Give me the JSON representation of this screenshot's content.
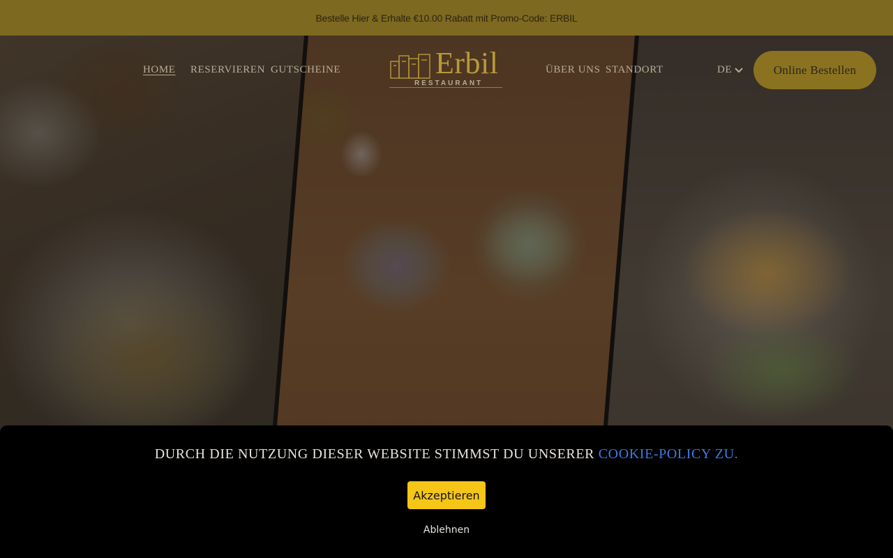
{
  "promo": {
    "text": "Bestelle Hier & Erhalte €10.00 Rabatt mit Promo-Code: ERBIL"
  },
  "nav": {
    "home": "HOME",
    "reserve": "RESERVIEREN",
    "vouchers": "GUTSCHEINE",
    "about": "ÜBER UNS",
    "location": "STANDORT",
    "language": "DE",
    "order_button": "Online Bestellen"
  },
  "logo": {
    "name": "Erbil",
    "subtitle": "RESTAURANT",
    "icon": "building-skyline-icon"
  },
  "cookie": {
    "text": "Durch die Nutzung dieser Website stimmst du unserer",
    "link": "Cookie-Policy zu.",
    "accept": "Akzeptieren",
    "decline": "Ablehnen"
  },
  "colors": {
    "promo_bg": "#7d691f",
    "accent_gold": "#b89a3a",
    "order_button_bg": "#8a7220",
    "accept_button_bg": "#f5c518",
    "cookie_link": "#3d7be0",
    "cookie_bg": "#000000"
  }
}
